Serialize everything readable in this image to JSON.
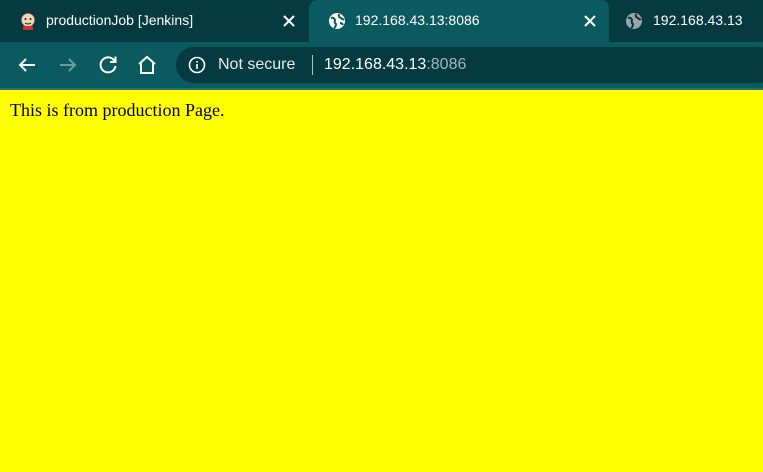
{
  "tabs": [
    {
      "title": "productionJob [Jenkins]",
      "favicon": "jenkins-icon"
    },
    {
      "title": "192.168.43.13:8086",
      "favicon": "globe-icon",
      "active": true
    },
    {
      "title": "192.168.43.13",
      "favicon": "globe-icon"
    }
  ],
  "toolbar": {
    "security_label": "Not secure",
    "url_host": "192.168.43.13",
    "url_port": ":8086"
  },
  "page": {
    "text": "This is from production Page.",
    "background": "#ffff00"
  },
  "colors": {
    "tabstrip": "#043a40",
    "toolbar": "#0a5a60"
  }
}
